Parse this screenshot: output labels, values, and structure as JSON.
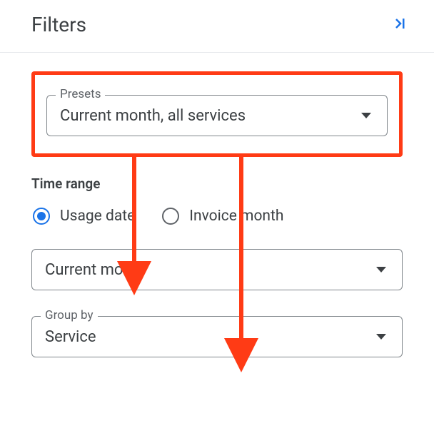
{
  "header": {
    "title": "Filters"
  },
  "presets": {
    "legend": "Presets",
    "value": "Current month, all services"
  },
  "timeRange": {
    "sectionLabel": "Time range",
    "options": {
      "usageDate": "Usage date",
      "invoiceMonth": "Invoice month"
    },
    "selectValue": "Current month"
  },
  "groupBy": {
    "legend": "Group by",
    "value": "Service"
  }
}
